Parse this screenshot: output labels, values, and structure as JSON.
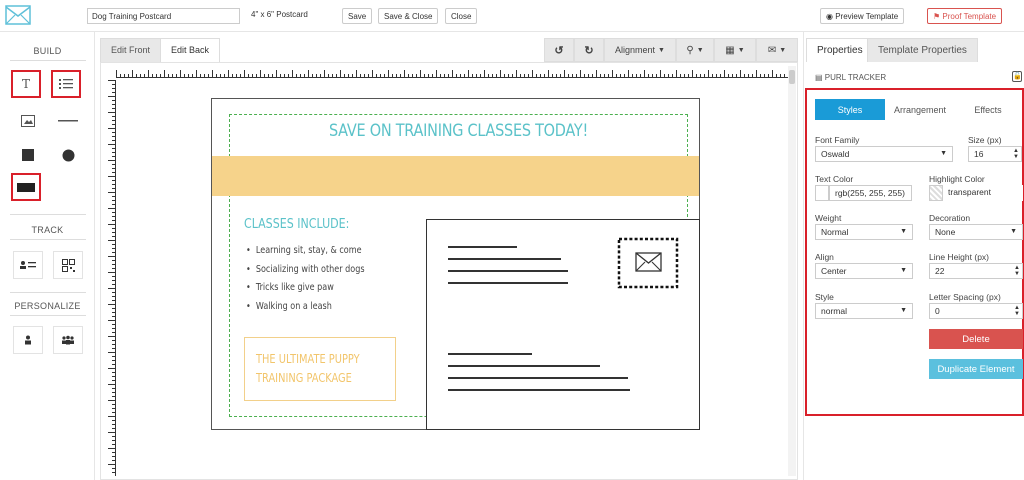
{
  "topbar": {
    "title_value": "Dog Training Postcard",
    "size_label": "4\" x 6\" Postcard",
    "save": "Save",
    "save_close": "Save & Close",
    "close": "Close",
    "preview": "Preview Template",
    "proof": "Proof Template"
  },
  "left": {
    "build": "BUILD",
    "track": "TRACK",
    "personalize": "PERSONALIZE",
    "tools": [
      "text-icon",
      "list-icon",
      "image-icon",
      "line-icon",
      "square-icon",
      "circle-icon",
      "rectangle-icon"
    ]
  },
  "editor": {
    "tabs": [
      "Edit Front",
      "Edit Back"
    ],
    "alignment": "Alignment",
    "undo_icon": "undo-icon",
    "redo_icon": "redo-icon"
  },
  "postcard": {
    "headline": "SAVE ON TRAINING CLASSES TODAY!",
    "classes_title": "CLASSES INCLUDE:",
    "bullets": [
      "Learning sit, stay, & come",
      "Socializing with other dogs",
      "Tricks like give paw",
      "Walking on a leash"
    ],
    "package_line1": "THE ULTIMATE PUPPY",
    "package_line2": "TRAINING PACKAGE",
    "band_color": "#f6d38b",
    "accent_color": "#5bc2c9"
  },
  "right": {
    "tabs": [
      "Properties",
      "Template Properties"
    ],
    "purl": "PURL TRACKER",
    "segments": [
      "Styles",
      "Arrangement",
      "Effects"
    ],
    "font_family_label": "Font Family",
    "font_family": "Oswald",
    "size_label": "Size (px)",
    "size": "16",
    "text_color_label": "Text Color",
    "text_color": "rgb(255, 255, 255)",
    "highlight_label": "Highlight Color",
    "highlight": "transparent",
    "weight_label": "Weight",
    "weight": "Normal",
    "decoration_label": "Decoration",
    "decoration": "None",
    "align_label": "Align",
    "align": "Center",
    "line_height_label": "Line Height (px)",
    "line_height": "22",
    "style_label": "Style",
    "style": "normal",
    "letter_spacing_label": "Letter Spacing (px)",
    "letter_spacing": "0",
    "delete": "Delete",
    "duplicate": "Duplicate Element"
  }
}
